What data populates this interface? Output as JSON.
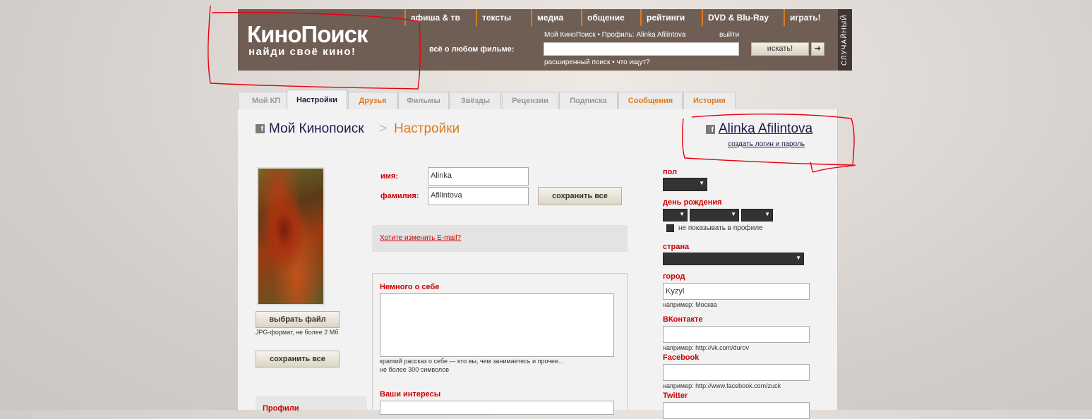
{
  "header": {
    "logo_main": "КиноПоиск",
    "logo_tagline": "найди своё кино!",
    "nav": [
      "афиша & тв",
      "тексты",
      "медиа",
      "общение",
      "рейтинги",
      "DVD & Blu-Ray",
      "играть!"
    ],
    "search_label": "всё о любом фильме:",
    "profile_line": "Мой КиноПоиск • Профиль: Alinka Afilintova",
    "logout": "выйти",
    "search_placeholder": "",
    "search_button": "искать!",
    "search_go": "➔",
    "advanced": "расширенный поиск • что ищут?",
    "random": "СЛУЧАЙНЫЙ"
  },
  "tabs": [
    {
      "label": "Мой КП"
    },
    {
      "label": "Настройки"
    },
    {
      "label": "Друзья"
    },
    {
      "label": "Фильмы"
    },
    {
      "label": "Звёзды"
    },
    {
      "label": "Рецензии"
    },
    {
      "label": "Подписка"
    },
    {
      "label": "Сообщения"
    },
    {
      "label": "История"
    }
  ],
  "breadcrumb": {
    "home": "Мой Кинопоиск",
    "separator": ">",
    "current": "Настройки",
    "fb_icon": "f"
  },
  "user": {
    "name": "Alinka Afilintova",
    "create_login": "создать логин и пароль"
  },
  "photo": {
    "choose_file": "выбрать файл",
    "format_note": "JPG-формат, не более 2 Мб",
    "save_all": "сохранить все",
    "profiles_label": "Профили"
  },
  "form": {
    "name_label": "имя:",
    "name_value": "Alinka",
    "surname_label": "фамилия:",
    "surname_value": "Afilintova",
    "save_all": "сохранить все",
    "email_link": "Хотите изменить E-mail?",
    "about_label": "Немного о себе",
    "about_hint": "краткий рассказ о себе — кто вы, чем занимаетесь и прочее...",
    "about_limit": "не более 300 символов",
    "interests_label": "Ваши интересы"
  },
  "right": {
    "sex_label": "пол",
    "birthday_label": "день рождения",
    "hide_label": "не показывать в профиле",
    "country_label": "страна",
    "city_label": "город",
    "city_value": "Kyzyl",
    "city_hint": "например: Москва",
    "vk_label": "ВКонтакте",
    "vk_hint": "например: http://vk.com/durov",
    "fb_label": "Facebook",
    "fb_hint": "например: http://www.facebook.com/zuck",
    "tw_label": "Twitter"
  },
  "colors": {
    "header_bg": "#6f5e53",
    "accent_orange": "#e07a1b",
    "label_red": "#cc0000",
    "link_navy": "#1a1a4b",
    "annotation_red": "#e8000f"
  }
}
